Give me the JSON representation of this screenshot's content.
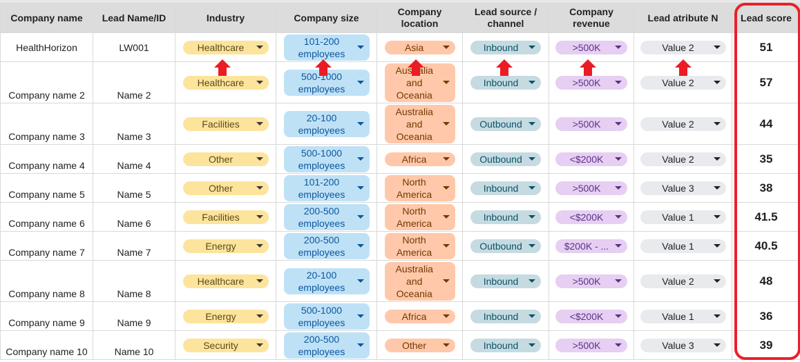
{
  "columns": [
    "Company name",
    "Lead Name/ID",
    "Industry",
    "Company size",
    "Company location",
    "Lead source / channel",
    "Company revenue",
    "Lead atribute N",
    "Lead score"
  ],
  "rows": [
    {
      "company": "HealthHorizon",
      "lead": "LW001",
      "industry": "Healthcare",
      "size": "101-200 employees",
      "location": "Asia",
      "source": "Inbound",
      "revenue": ">500K",
      "attribute": "Value 2",
      "score": "51"
    },
    {
      "company": "Company name 2",
      "lead": "Name 2",
      "industry": "Healthcare",
      "size": "500-1000 employees",
      "location": "Australia and Oceania",
      "source": "Inbound",
      "revenue": ">500K",
      "attribute": "Value 2",
      "score": "57"
    },
    {
      "company": "Company name 3",
      "lead": "Name 3",
      "industry": "Facilities",
      "size": "20-100 employees",
      "location": "Australia and Oceania",
      "source": "Outbound",
      "revenue": ">500K",
      "attribute": "Value 2",
      "score": "44"
    },
    {
      "company": "Company name 4",
      "lead": "Name 4",
      "industry": "Other",
      "size": "500-1000 employees",
      "location": "Africa",
      "source": "Outbound",
      "revenue": "<$200K",
      "attribute": "Value 2",
      "score": "35"
    },
    {
      "company": "Company name 5",
      "lead": "Name 5",
      "industry": "Other",
      "size": "101-200 employees",
      "location": "North America",
      "source": "Inbound",
      "revenue": ">500K",
      "attribute": "Value 3",
      "score": "38"
    },
    {
      "company": "Company name 6",
      "lead": "Name 6",
      "industry": "Facilities",
      "size": "200-500 employees",
      "location": "North America",
      "source": "Inbound",
      "revenue": "<$200K",
      "attribute": "Value 1",
      "score": "41.5"
    },
    {
      "company": "Company name 7",
      "lead": "Name 7",
      "industry": "Energy",
      "size": "200-500 employees",
      "location": "North America",
      "source": "Outbound",
      "revenue": "$200K - ...",
      "attribute": "Value 1",
      "score": "40.5"
    },
    {
      "company": "Company name 8",
      "lead": "Name 8",
      "industry": "Healthcare",
      "size": "20-100 employees",
      "location": "Australia and Oceania",
      "source": "Inbound",
      "revenue": ">500K",
      "attribute": "Value 2",
      "score": "48"
    },
    {
      "company": "Company name 9",
      "lead": "Name 9",
      "industry": "Energy",
      "size": "500-1000 employees",
      "location": "Africa",
      "source": "Inbound",
      "revenue": "<$200K",
      "attribute": "Value 1",
      "score": "36"
    },
    {
      "company": "Company name 10",
      "lead": "Name 10",
      "industry": "Security",
      "size": "200-500 employees",
      "location": "Other",
      "source": "Inbound",
      "revenue": ">500K",
      "attribute": "Value 3",
      "score": "39"
    }
  ],
  "annotations": {
    "arrow_color": "#ea1c24",
    "highlight_color": "#e8212b",
    "arrow_targets": [
      "Industry",
      "Company size",
      "Company location",
      "Lead source / channel",
      "Company revenue",
      "Lead atribute N"
    ],
    "highlighted_column": "Lead score"
  },
  "chip_colors": {
    "industry": "#fde49c",
    "size": "#bfe1f6",
    "location": "#ffc8aa",
    "source": "#c6dbe1",
    "revenue": "#e6cff2",
    "attribute": "#e8eaed"
  }
}
